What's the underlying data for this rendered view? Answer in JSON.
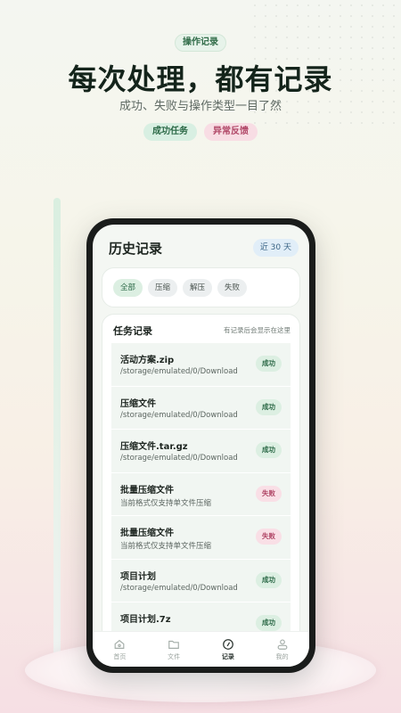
{
  "promo": {
    "chip": "操作记录",
    "headline": "每次处理，都有记录",
    "subline": "成功、失败与操作类型一目了然",
    "tags": [
      "成功任务",
      "异常反馈"
    ]
  },
  "app": {
    "title": "历史记录",
    "range_chip": "近 30 天",
    "filters": [
      "全部",
      "压缩",
      "解压",
      "失败"
    ],
    "active_filter": "全部",
    "task_section": {
      "title": "任务记录",
      "hint": "有记录后会显示在这里"
    },
    "tasks": [
      {
        "name": "活动方案.zip",
        "path": "/storage/emulated/0/Download",
        "status": "成功",
        "state": "ok"
      },
      {
        "name": "压缩文件",
        "path": "/storage/emulated/0/Download",
        "status": "成功",
        "state": "ok"
      },
      {
        "name": "压缩文件.tar.gz",
        "path": "/storage/emulated/0/Download",
        "status": "成功",
        "state": "ok"
      },
      {
        "name": "批量压缩文件",
        "path": "当前格式仅支持单文件压缩",
        "status": "失败",
        "state": "fail"
      },
      {
        "name": "批量压缩文件",
        "path": "当前格式仅支持单文件压缩",
        "status": "失败",
        "state": "fail"
      },
      {
        "name": "项目计划",
        "path": "/storage/emulated/0/Download",
        "status": "成功",
        "state": "ok"
      },
      {
        "name": "项目计划.7z",
        "path": "",
        "status": "成功",
        "state": "ok"
      }
    ],
    "tabs": [
      {
        "label": "首页",
        "icon": "home-icon"
      },
      {
        "label": "文件",
        "icon": "folder-icon"
      },
      {
        "label": "记录",
        "icon": "history-icon",
        "active": true
      },
      {
        "label": "我的",
        "icon": "user-icon"
      }
    ]
  },
  "colors": {
    "success_bg": "#dcefe2",
    "success_text": "#2d6a48",
    "fail_bg": "#f9dfe6",
    "fail_text": "#b14868",
    "accent_blue": "#3a6485"
  }
}
